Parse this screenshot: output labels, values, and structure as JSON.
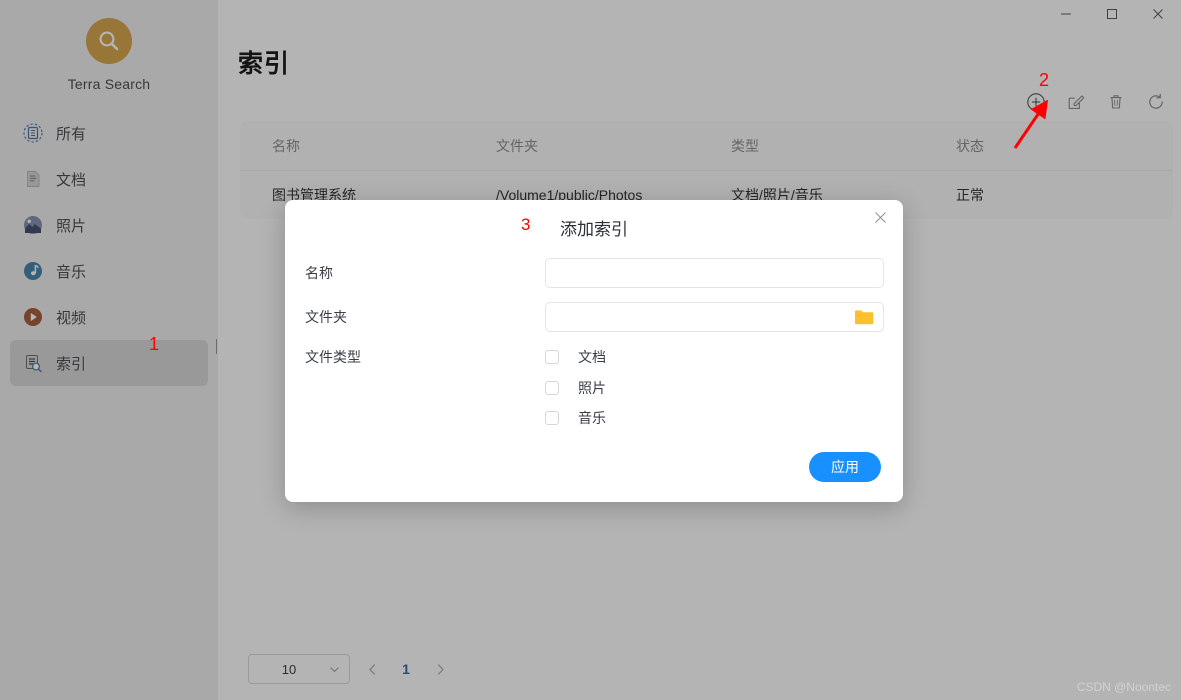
{
  "window": {
    "controls": [
      {
        "name": "minimize",
        "glyph": "minimize-icon"
      },
      {
        "name": "maximize",
        "glyph": "maximize-icon"
      },
      {
        "name": "close",
        "glyph": "close-icon"
      }
    ]
  },
  "sidebar": {
    "brand_name": "Terra Search",
    "logo_icon": "search-magnifier-icon",
    "logo_color": "#f9a403",
    "items": [
      {
        "label": "所有",
        "icon": "all-files-icon"
      },
      {
        "label": "文档",
        "icon": "document-icon"
      },
      {
        "label": "照片",
        "icon": "photo-icon"
      },
      {
        "label": "音乐",
        "icon": "music-note-icon"
      },
      {
        "label": "视频",
        "icon": "video-play-icon"
      },
      {
        "label": "索引",
        "icon": "index-search-icon"
      }
    ],
    "selected_index": 5
  },
  "main": {
    "page_title": "索引",
    "toolbar": [
      {
        "name": "add",
        "icon": "plus-circle-icon",
        "enabled": true
      },
      {
        "name": "edit",
        "icon": "pencil-square-icon",
        "enabled": false
      },
      {
        "name": "delete",
        "icon": "trash-icon",
        "enabled": false
      },
      {
        "name": "refresh",
        "icon": "refresh-icon",
        "enabled": false
      }
    ],
    "table": {
      "headers": [
        "名称",
        "文件夹",
        "类型",
        "状态"
      ],
      "rows": [
        {
          "name": "图书管理系统",
          "folder": "/Volume1/public/Photos",
          "type": "文档/照片/音乐",
          "status": "正常"
        }
      ]
    },
    "pagination": {
      "page_size": "10",
      "prev_icon": "chevron-left-icon",
      "next_icon": "chevron-right-icon",
      "current_page": "1",
      "accent_color": "#1b6fe0"
    }
  },
  "modal": {
    "title": "添加索引",
    "close_icon": "close-icon",
    "fields": {
      "name_label": "名称",
      "name_value": "",
      "folder_label": "文件夹",
      "folder_value": "",
      "folder_browse_icon": "folder-icon",
      "filetype_label": "文件类型"
    },
    "checkboxes": [
      {
        "label": "文档",
        "checked": false
      },
      {
        "label": "照片",
        "checked": false
      },
      {
        "label": "音乐",
        "checked": false
      }
    ],
    "apply_label": "应用",
    "apply_color": "#1890ff"
  },
  "annotations": {
    "marker_1": "1",
    "marker_2": "2",
    "marker_3": "3",
    "arrow_icon": "red-arrow-icon",
    "color": "#ff0000"
  },
  "watermark": "CSDN @Noontec"
}
